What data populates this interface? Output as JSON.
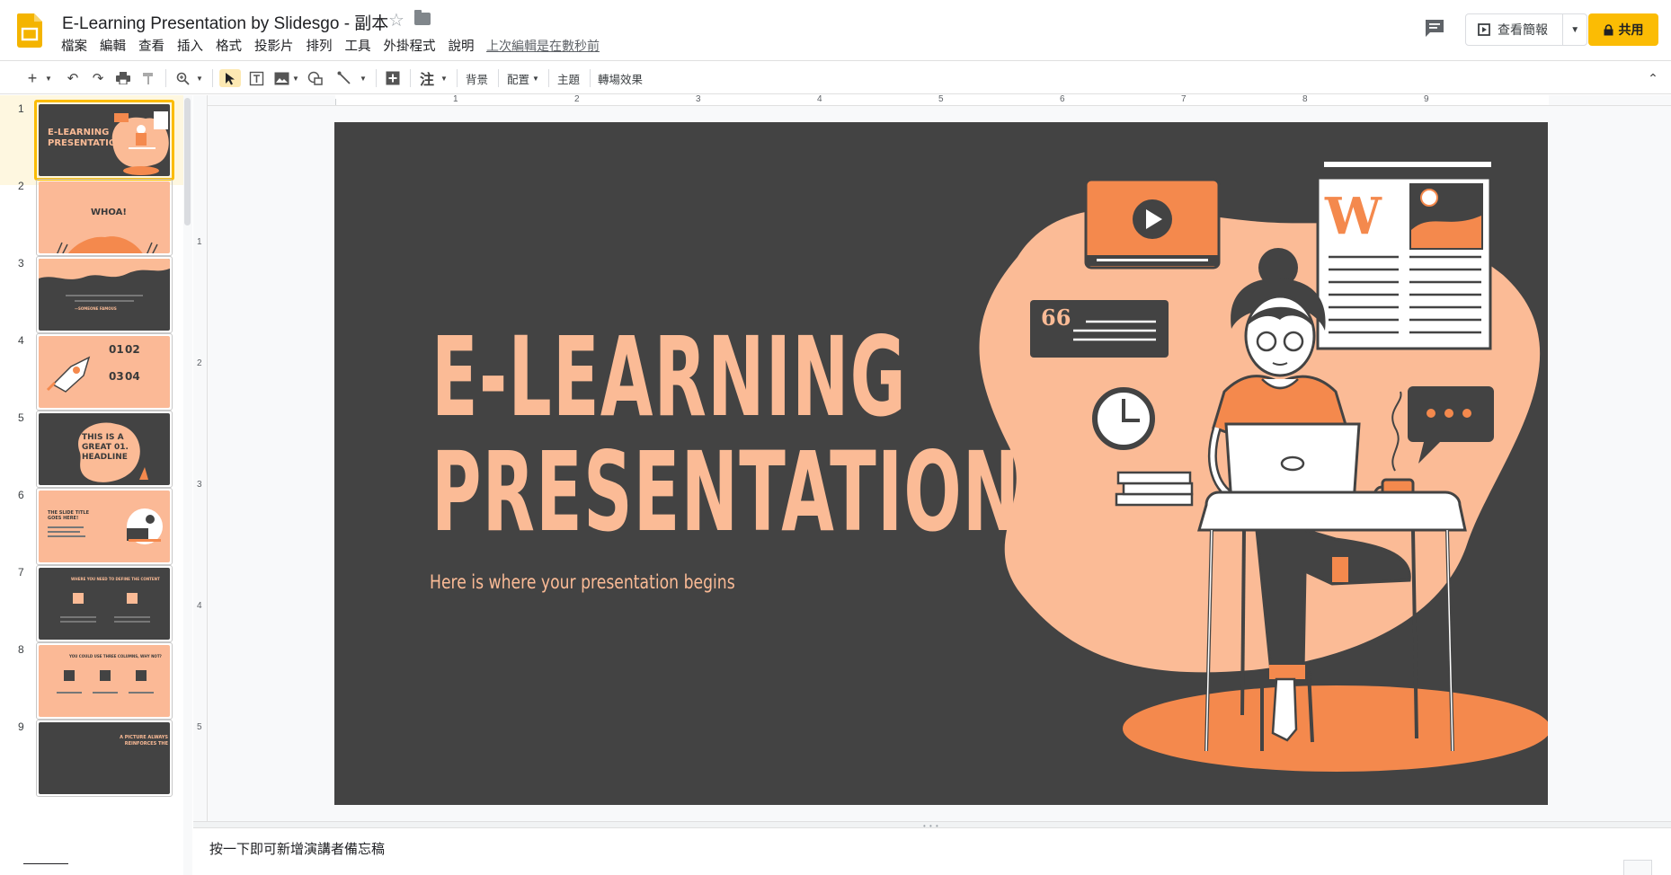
{
  "header": {
    "title": "E-Learning Presentation by Slidesgo - 副本",
    "last_edit": "上次編輯是在數秒前",
    "present_label": "查看簡報",
    "share_label": "共用",
    "menu": [
      "檔案",
      "編輯",
      "查看",
      "插入",
      "格式",
      "投影片",
      "排列",
      "工具",
      "外掛程式",
      "說明"
    ]
  },
  "toolbar": {
    "background_label": "背景",
    "layout_label": "配置",
    "theme_label": "主題",
    "transition_label": "轉場效果",
    "note_glyph": "注"
  },
  "filmstrip": {
    "slides": [
      {
        "num": "1",
        "text": "E-LEARNING PRESENTATION"
      },
      {
        "num": "2",
        "text": "WHOA!"
      },
      {
        "num": "3",
        "text": "—SOMEONE FAMOUS"
      },
      {
        "num": "4",
        "text_a": "01",
        "text_b": "02",
        "text_c": "03",
        "text_d": "04"
      },
      {
        "num": "5",
        "text": "THIS IS A GREAT 01. HEADLINE"
      },
      {
        "num": "6",
        "text": "THE SLIDE TITLE GOES HERE!"
      },
      {
        "num": "7",
        "text": "WHERE YOU NEED TO DEFINE THE CONTENT"
      },
      {
        "num": "8",
        "text": "YOU COULD USE THREE COLUMNS, WHY NOT?"
      },
      {
        "num": "9",
        "text": "A PICTURE ALWAYS REINFORCES THE"
      }
    ]
  },
  "rulers": {
    "h_numbers": [
      "1",
      "2",
      "3",
      "4",
      "5",
      "6",
      "7",
      "8",
      "9"
    ],
    "v_numbers": [
      "1",
      "2",
      "3",
      "4",
      "5"
    ]
  },
  "slide": {
    "title_line1": "E-LEARNING",
    "title_line2": "PRESENTATION",
    "subtitle": "Here is where your presentation begins",
    "wiki_letter": "W",
    "quote_glyph": "66"
  },
  "notes": {
    "placeholder": "按一下即可新增演講者備忘稿"
  },
  "colors": {
    "slide_bg": "#434343",
    "peach": "#fbbb96",
    "orange": "#f4894d",
    "share_yellow": "#fbbc04"
  }
}
